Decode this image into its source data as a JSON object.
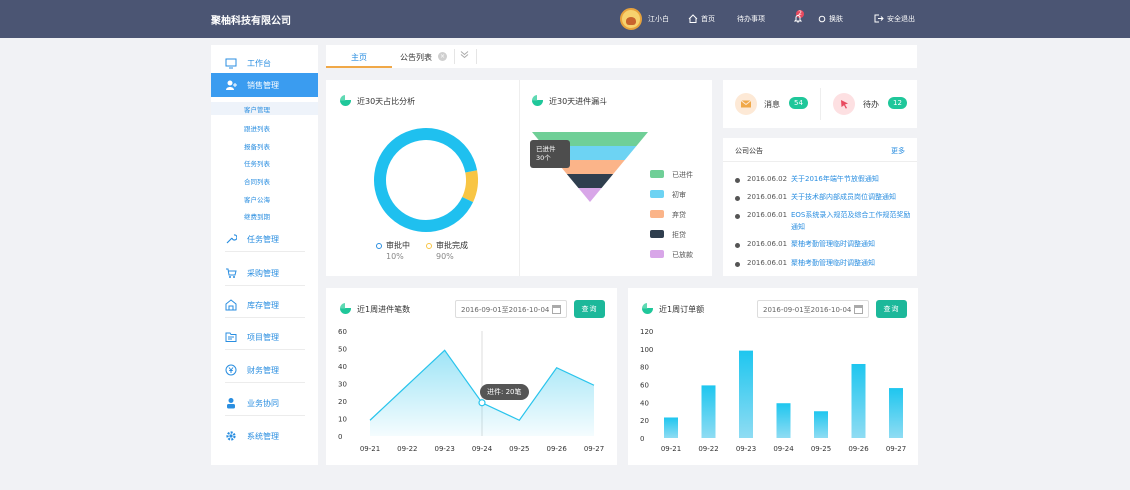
{
  "header": {
    "company": "聚柚科技有限公司",
    "user": "江小白",
    "home": "首页",
    "todo": "待办事项",
    "todo_badge": "2",
    "skin": "换肤",
    "logout": "安全退出",
    "colors": {
      "bar": "#4b5573",
      "accent": "#3a9cf0",
      "teal": "#1fc79a"
    }
  },
  "sidebar": {
    "items": [
      {
        "label": "工作台",
        "icon": "monitor-icon"
      },
      {
        "label": "销售管理",
        "icon": "users-icon"
      },
      {
        "label": "任务管理",
        "icon": "wrench-icon"
      },
      {
        "label": "采购管理",
        "icon": "cart-icon"
      },
      {
        "label": "库存管理",
        "icon": "warehouse-icon"
      },
      {
        "label": "项目管理",
        "icon": "folder-icon"
      },
      {
        "label": "财务管理",
        "icon": "money-icon"
      },
      {
        "label": "业务协同",
        "icon": "person-icon"
      },
      {
        "label": "系统管理",
        "icon": "gear-icon"
      }
    ],
    "subitems": [
      "客户管理",
      "跟进列表",
      "报备列表",
      "任务列表",
      "合同列表",
      "客户公海",
      "继费到期"
    ]
  },
  "tabs": {
    "main": "主页",
    "second": "公告列表"
  },
  "donut": {
    "title": "近30天占比分析",
    "legend": [
      {
        "label": "审批中",
        "value": "10%"
      },
      {
        "label": "审批完成",
        "value": "90%"
      }
    ]
  },
  "funnel": {
    "title": "近30天进件漏斗",
    "tooltip_line1": "已进件",
    "tooltip_line2": "30个",
    "legend": [
      "已进件",
      "初审",
      "弃贷",
      "拒贷",
      "已放款"
    ],
    "colors": [
      "#6fcf97",
      "#6dd3f3",
      "#fbb489",
      "#2f3e4e",
      "#d8a6e8"
    ]
  },
  "messages": {
    "msg_label": "消息",
    "msg_count": "54",
    "todo_label": "待办",
    "todo_count": "12"
  },
  "notice": {
    "title": "公司公告",
    "more": "更多",
    "items": [
      {
        "date": "2016.06.02",
        "text": "关于2016年端午节放假通知"
      },
      {
        "date": "2016.06.01",
        "text": "关于技术部内部成员岗位调整通知"
      },
      {
        "date": "2016.06.01",
        "text": "EOS系统录入规范及综合工作规范奖励通知"
      },
      {
        "date": "2016.06.01",
        "text": "聚柚考勤管理临时调整通知"
      },
      {
        "date": "2016.06.01",
        "text": "聚柚考勤管理临时调整通知"
      }
    ]
  },
  "line_panel": {
    "title": "近1周进件笔数",
    "date_range": "2016-09-01至2016-10-04",
    "query": "查询",
    "tooltip": "进件: 20笔"
  },
  "bar_panel": {
    "title": "近1周订单额",
    "date_range": "2016-09-01至2016-10-04",
    "query": "查询"
  },
  "chart_data": [
    {
      "type": "pie",
      "title": "近30天占比分析",
      "labels": [
        "审批中",
        "审批完成"
      ],
      "values": [
        10,
        90
      ],
      "colors": [
        "#f8c544",
        "#1fc0ef"
      ]
    },
    {
      "type": "bar",
      "title": "近30天进件漏斗",
      "categories": [
        "已进件",
        "初审",
        "弃贷",
        "拒贷",
        "已放款"
      ],
      "values": [
        30,
        24,
        18,
        12,
        6
      ]
    },
    {
      "type": "line",
      "title": "近1周进件笔数",
      "x": [
        "09-21",
        "09-22",
        "09-23",
        "09-24",
        "09-25",
        "09-26",
        "09-27"
      ],
      "values": [
        9,
        29,
        49,
        19,
        9,
        39,
        29
      ],
      "ylim": [
        0,
        60
      ],
      "yticks": [
        0,
        10,
        20,
        30,
        40,
        50,
        60
      ]
    },
    {
      "type": "bar",
      "title": "近1周订单额",
      "categories": [
        "09-21",
        "09-22",
        "09-23",
        "09-24",
        "09-25",
        "09-26",
        "09-27"
      ],
      "values": [
        23,
        59,
        98,
        39,
        30,
        83,
        56
      ],
      "ylim": [
        0,
        120
      ],
      "yticks": [
        0,
        20,
        40,
        60,
        80,
        100,
        120
      ]
    }
  ]
}
